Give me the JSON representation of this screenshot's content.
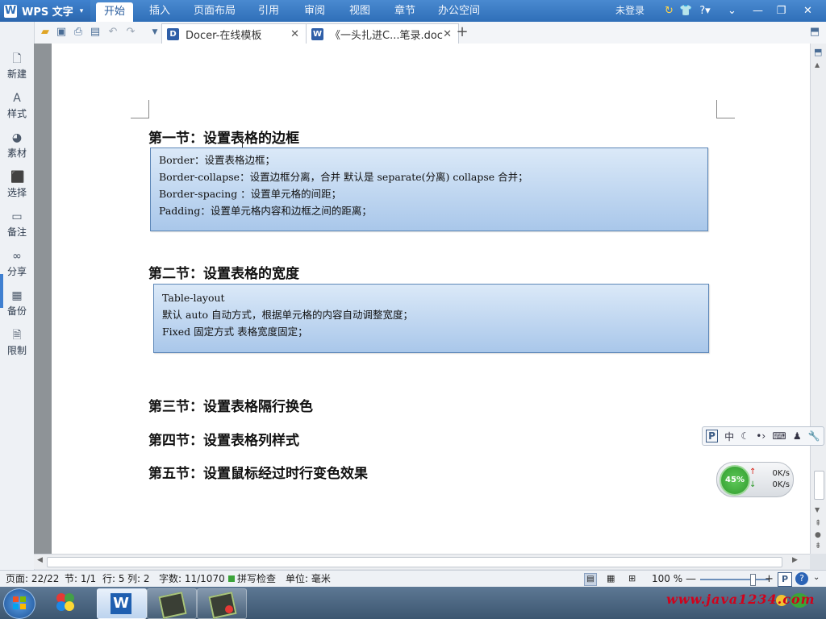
{
  "app": {
    "name": "WPS 文字",
    "logo": "W"
  },
  "ribbon_tabs": [
    "开始",
    "插入",
    "页面布局",
    "引用",
    "审阅",
    "视图",
    "章节",
    "办公空间"
  ],
  "active_tab_index": 0,
  "title_right": {
    "login": "未登录"
  },
  "doc_tabs": [
    {
      "label": "Docer-在线模板",
      "icon": "D"
    },
    {
      "label": "《一头扎进C...笔录.doc",
      "icon": "W"
    }
  ],
  "sidebar": {
    "items": [
      {
        "label": "新建",
        "icon": "new-doc-icon"
      },
      {
        "label": "样式",
        "icon": "style-icon"
      },
      {
        "label": "素材",
        "icon": "material-icon"
      },
      {
        "label": "选择",
        "icon": "select-icon"
      },
      {
        "label": "备注",
        "icon": "comment-icon"
      },
      {
        "label": "分享",
        "icon": "share-link-icon"
      },
      {
        "label": "备份",
        "icon": "backup-icon"
      },
      {
        "label": "限制",
        "icon": "restrict-icon"
      }
    ]
  },
  "document": {
    "sections": [
      {
        "heading": "第一节：设置表格的边框",
        "lines": [
          "Border：设置表格边框；",
          "Border-collapse：设置边框分离，合并   默认是 separate(分离)   collapse  合并；",
          "Border-spacing ：设置单元格的间距；",
          "Padding：设置单元格内容和边框之间的距离；"
        ]
      },
      {
        "heading": "第二节：设置表格的宽度",
        "lines": [
          "Table-layout",
          "默认  auto     自动方式，根据单元格的内容自动调整宽度；",
          "Fixed  固定方式  表格宽度固定；"
        ]
      },
      {
        "heading": "第三节：设置表格隔行换色",
        "lines": []
      },
      {
        "heading": "第四节：设置表格列样式",
        "lines": []
      },
      {
        "heading": "第五节：设置鼠标经过时行变色效果",
        "lines": []
      }
    ]
  },
  "ime_bar": {
    "logo": "P",
    "mode": "中"
  },
  "net_widget": {
    "percent": "45%",
    "upload": "0K/s",
    "download": "0K/s"
  },
  "status": {
    "page": "页面: 22/22",
    "section": "节: 1/1",
    "row": "行: 5",
    "col": "列: 2",
    "words": "字数: 11/1070",
    "spell": "拼写检查",
    "unit": "单位: 毫米",
    "zoom": "100 %",
    "zoom_level": 0.76
  },
  "watermark": "www.java1234.com",
  "colors": {
    "title_blue": "#2f6fb8",
    "box_top": "#dbe9f8",
    "box_bottom": "#a9c7ea",
    "accent": "#3f7fd0",
    "watermark": "#d0021b"
  }
}
